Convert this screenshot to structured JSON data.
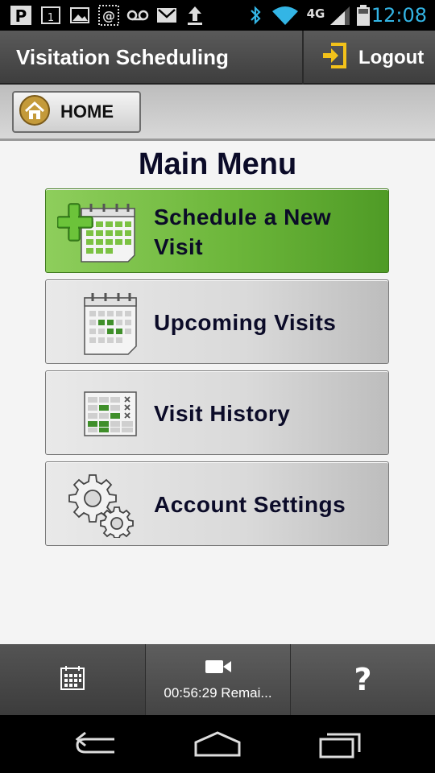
{
  "status_bar": {
    "time": "12:08",
    "network_label": "4G",
    "left_icons": [
      "parking-icon",
      "calendar-1-icon",
      "image-icon",
      "at-icon",
      "voicemail-icon",
      "gmail-icon",
      "upload-icon"
    ],
    "right_icons": [
      "bluetooth-icon",
      "wifi-icon",
      "signal-icon",
      "battery-icon"
    ]
  },
  "header": {
    "title": "Visitation Scheduling",
    "logout_label": "Logout"
  },
  "home": {
    "label": "HOME"
  },
  "main": {
    "title": "Main Menu",
    "items": [
      {
        "label": "Schedule a New Visit",
        "icon": "calendar-add-icon"
      },
      {
        "label": "Upcoming Visits",
        "icon": "calendar-icon"
      },
      {
        "label": "Visit History",
        "icon": "history-grid-icon"
      },
      {
        "label": "Account Settings",
        "icon": "gears-icon"
      }
    ]
  },
  "bottom_tabs": {
    "calendar_icon": "calendar-icon",
    "timer_label": "00:56:29 Remai...",
    "help_label": "?"
  },
  "colors": {
    "accent_green": "#6cb63a",
    "status_blue": "#33b5e5",
    "header_dark": "#4a4a4a",
    "title_navy": "#0b0b28"
  }
}
